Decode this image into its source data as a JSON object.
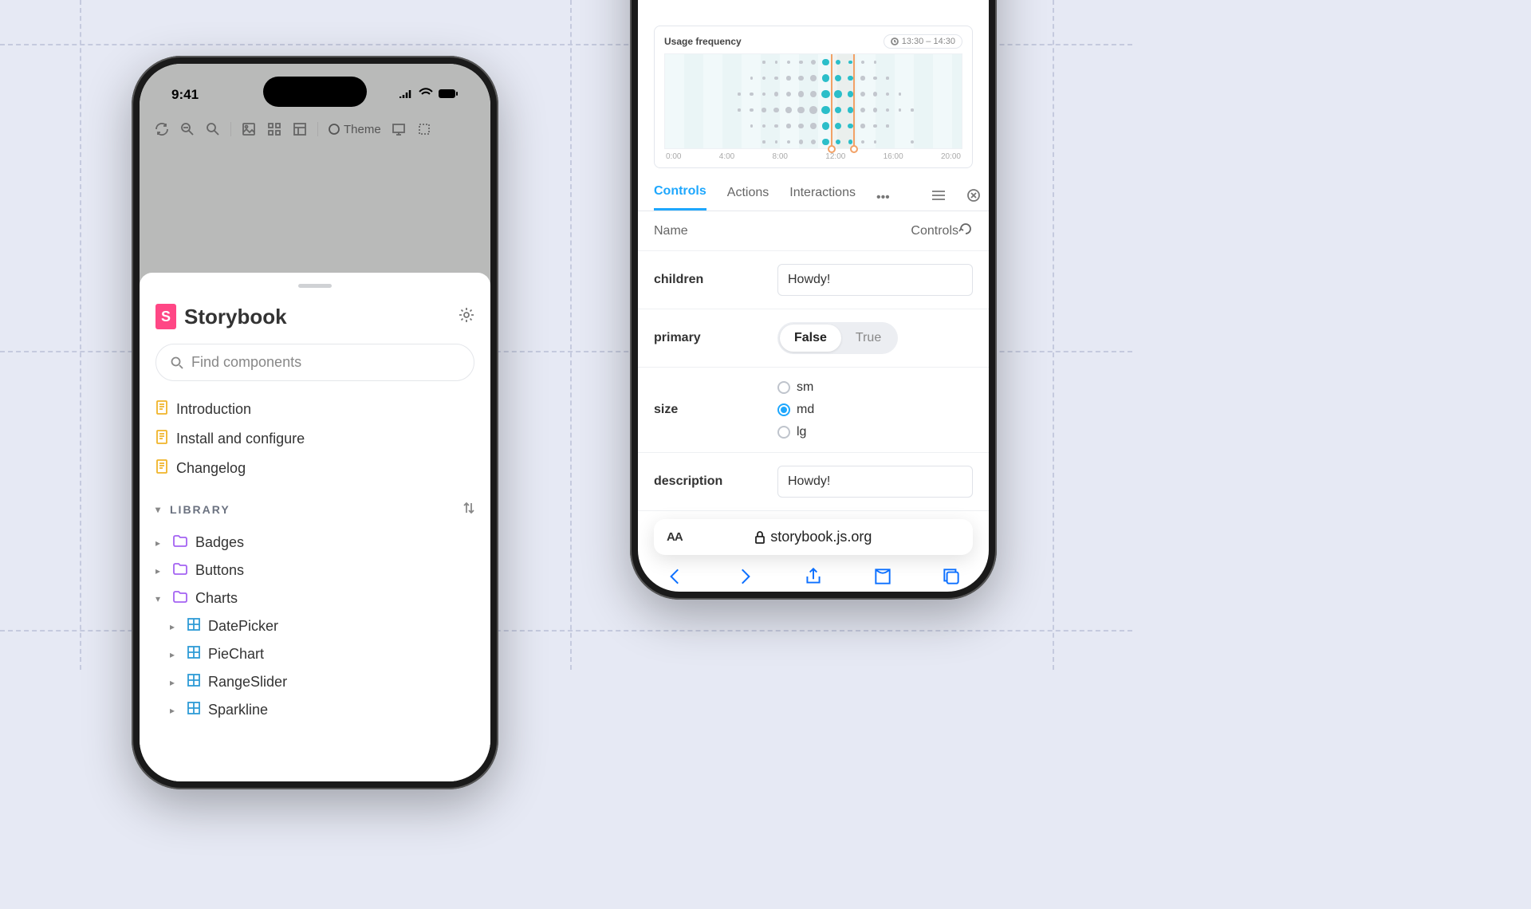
{
  "left": {
    "status_time": "9:41",
    "toolbar": {
      "theme": "Theme"
    },
    "brand": "Storybook",
    "search_placeholder": "Find components",
    "docs": [
      "Introduction",
      "Install and configure",
      "Changelog"
    ],
    "library_title": "LIBRARY",
    "folders": [
      "Badges",
      "Buttons",
      "Charts"
    ],
    "charts_children": [
      "DatePicker",
      "PieChart",
      "RangeSlider",
      "Sparkline"
    ]
  },
  "right": {
    "chart": {
      "title": "Usage frequency",
      "badge": "13:30 – 14:30"
    },
    "tabs": [
      "Controls",
      "Actions",
      "Interactions"
    ],
    "head_name": "Name",
    "head_controls": "Controls",
    "rows": {
      "children": {
        "label": "children",
        "value": "Howdy!"
      },
      "primary": {
        "label": "primary",
        "false": "False",
        "true": "True"
      },
      "size": {
        "label": "size",
        "opts": [
          "sm",
          "md",
          "lg"
        ]
      },
      "description": {
        "label": "description",
        "value": "Howdy!"
      }
    },
    "url": "storybook.js.org"
  },
  "chart_data": {
    "type": "scatter",
    "title": "Usage frequency",
    "xlabel": "",
    "ylabel": "",
    "x_ticks": [
      "0:00",
      "4:00",
      "8:00",
      "12:00",
      "16:00",
      "20:00"
    ],
    "selected_range": "13:30 – 14:30",
    "series": [
      {
        "name": "row0",
        "values_by_hour": {
          "8": 0.5,
          "9": 0.5,
          "10": 1,
          "11": 1,
          "12": 2,
          "13": 3,
          "14": 2,
          "15": 1,
          "16": 1,
          "17": 0.5
        }
      },
      {
        "name": "row1",
        "values_by_hour": {
          "7": 0.5,
          "8": 1,
          "9": 1,
          "10": 1.5,
          "11": 2,
          "12": 2.5,
          "13": 3.5,
          "14": 3,
          "15": 2,
          "16": 1.5,
          "17": 1,
          "18": 0.5
        }
      },
      {
        "name": "row2",
        "values_by_hour": {
          "6": 0.5,
          "7": 1,
          "8": 1,
          "9": 1.5,
          "10": 2,
          "11": 2.5,
          "12": 3,
          "13": 4,
          "14": 3.5,
          "15": 2.5,
          "16": 2,
          "17": 1.5,
          "18": 1,
          "19": 0.5
        }
      },
      {
        "name": "row3",
        "values_by_hour": {
          "6": 0.5,
          "7": 1,
          "8": 1.5,
          "9": 2,
          "10": 2.5,
          "11": 3,
          "12": 3.5,
          "13": 4,
          "14": 3,
          "15": 2.5,
          "16": 2,
          "17": 1.5,
          "18": 1,
          "19": 0.5,
          "20": 0.5
        }
      },
      {
        "name": "row4",
        "values_by_hour": {
          "7": 0.5,
          "8": 1,
          "9": 1,
          "10": 1.5,
          "11": 2,
          "12": 2.5,
          "13": 3.5,
          "14": 3,
          "15": 2,
          "16": 1.5,
          "17": 1,
          "18": 0.5
        }
      },
      {
        "name": "row5",
        "values_by_hour": {
          "8": 0.5,
          "9": 0.5,
          "10": 1,
          "11": 1.5,
          "12": 2,
          "13": 3,
          "14": 2,
          "15": 1.5,
          "16": 1,
          "17": 0.5,
          "20": 1
        }
      }
    ]
  }
}
